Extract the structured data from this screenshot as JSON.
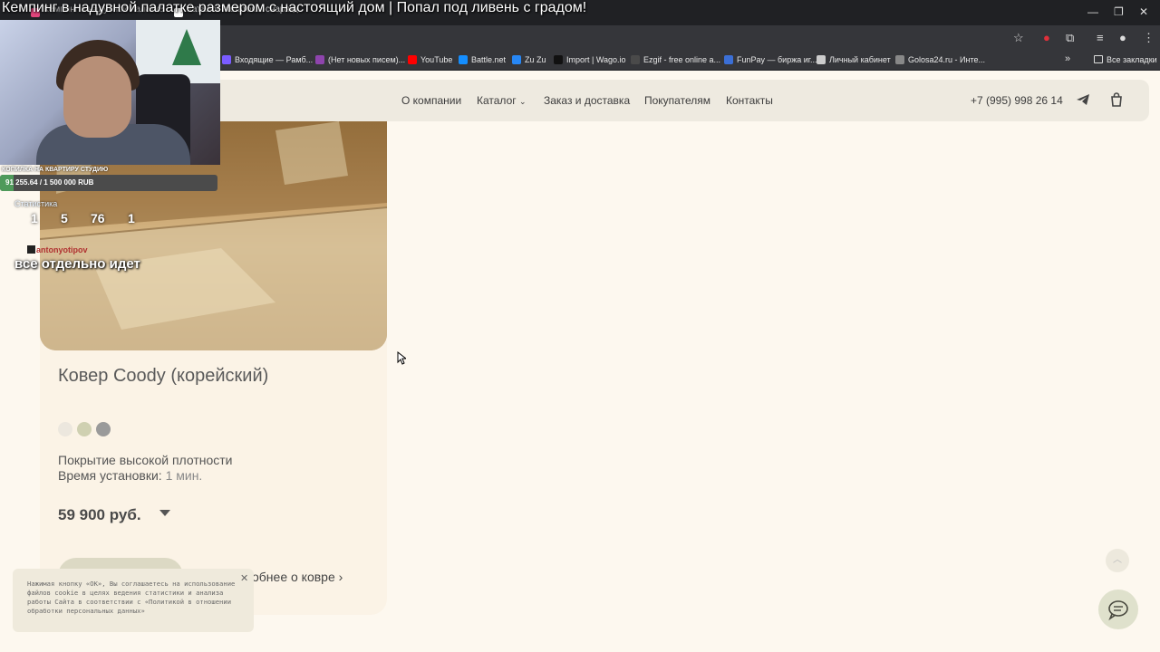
{
  "stream": {
    "title": "Кемпинг в надувной палатке размером с настоящий дом | Попал под ливень с градом!"
  },
  "browser": {
    "tabs": [
      {
        "label": "Кемпинг в надувной палатке",
        "color": "#e0457b"
      },
      {
        "label": "Каталог палаток и снаряжения",
        "color": "#ffffff"
      }
    ],
    "bookmarks": [
      {
        "label": "Входящие — Рамб...",
        "color": "#7a5cff"
      },
      {
        "label": "(Нет новых писем)...",
        "color": "#8e44ad"
      },
      {
        "label": "YouTube",
        "color": "#ff0000"
      },
      {
        "label": "Battle.net",
        "color": "#148eff"
      },
      {
        "label": "Zu Zu",
        "color": "#2787f5"
      },
      {
        "label": "Import | Wago.io",
        "color": "#111111"
      },
      {
        "label": "Ezgif - free online a...",
        "color": "#4a4a4a"
      },
      {
        "label": "FunPay — биржа иг...",
        "color": "#3b6fd6"
      },
      {
        "label": "Личный кабинет",
        "color": "#cccccc"
      },
      {
        "label": "Golosa24.ru - Инте...",
        "color": "#888888"
      }
    ],
    "all_bookmarks_label": "Все закладки"
  },
  "site": {
    "nav": [
      "О компании",
      "Каталог",
      "Заказ и доставка",
      "Покупателям",
      "Контакты"
    ],
    "phone": "+7 (995) 998 26 14"
  },
  "product": {
    "title": "Ковер Coody (корейский)",
    "swatches": [
      "#ece7de",
      "#cfd0b1",
      "#9a9a9a"
    ],
    "spec1_label": "Покрытие высокой плотности",
    "spec2_label": "Время установки:",
    "spec2_value": "1 мин.",
    "price": "59 900 руб.",
    "more_link": "обнее о ковре"
  },
  "cookie": {
    "text": "Нажимая кнопку «ОК», Вы соглашаетесь на использование файлов cookie в целях ведения статистики и анализа работы Сайта в соответствии с «Политикой в отношении обработки персональных данных»"
  },
  "overlay": {
    "donation_label": "КОПИЛКА НА КВАРТИРУ СТУДИЮ",
    "donation_value": "91 255.64 / 1 500 000 RUB",
    "donation_progress": 0.061,
    "stats_label": "Статистика",
    "stats": [
      "1",
      "5",
      "76",
      "1"
    ],
    "chat_user": "antonyotipov",
    "chat_message": "все отдельно идет"
  }
}
